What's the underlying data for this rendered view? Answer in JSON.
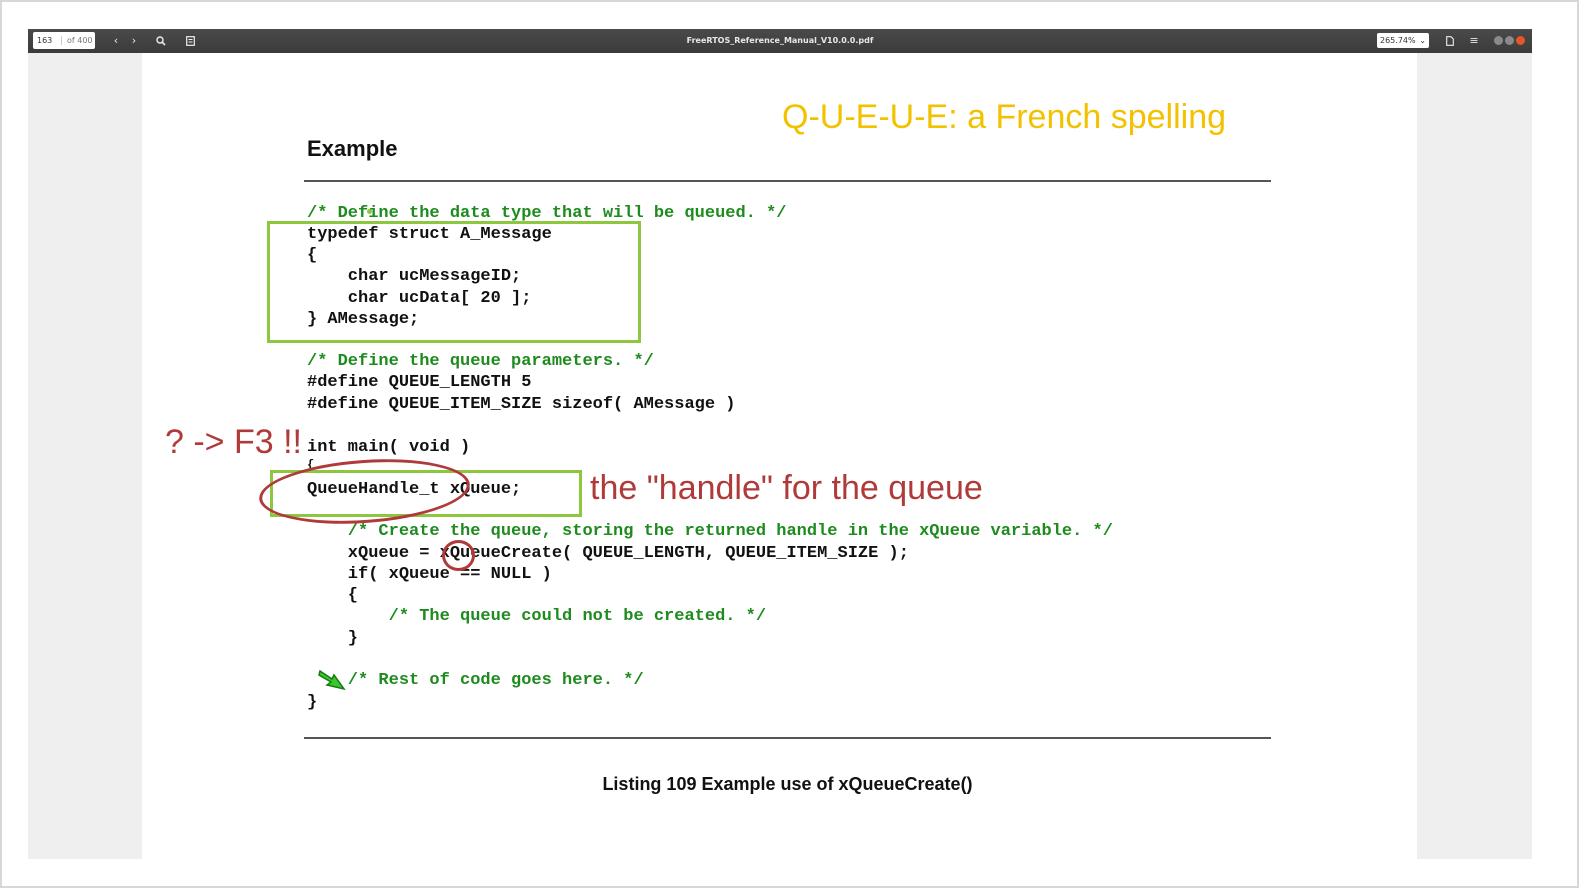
{
  "viewer": {
    "current_page": "163",
    "total_pages": "of 400",
    "document_title": "FreeRTOS_Reference_Manual_V10.0.0.pdf",
    "zoom": "265.74%"
  },
  "page": {
    "heading": "Example",
    "code": {
      "c1": "/* Define the data type that will be queued. */",
      "l1": "typedef struct A_Message",
      "l2": "{",
      "l3": "    char ucMessageID;",
      "l4": "    char ucData[ 20 ];",
      "l5": "} AMessage;",
      "c2": "/* Define the queue parameters. */",
      "l6": "#define QUEUE_LENGTH 5",
      "l7": "#define QUEUE_ITEM_SIZE sizeof( AMessage )",
      "l8": "int main( void )",
      "l9": "{",
      "l10": "QueueHandle_t xQueue;",
      "c3": "    /* Create the queue, storing the returned handle in the xQueue variable. */",
      "l11": "    xQueue = xQueueCreate( QUEUE_LENGTH, QUEUE_ITEM_SIZE );",
      "l12": "    if( xQueue == NULL )",
      "l13": "    {",
      "c4": "        /* The queue could not be created. */",
      "l14": "    }",
      "c5": "    /* Rest of code goes here. */",
      "l15": "}"
    },
    "caption": "Listing 109 Example use of xQueueCreate()"
  },
  "annotations": {
    "french": "Q-U-E-U-E: a French spelling",
    "f3": "? -> F3 !!",
    "handle": "the \"handle\" for the queue",
    "colors": {
      "green": "#8dc63f",
      "red": "#b03a3a",
      "yellow": "#f2c200"
    }
  }
}
